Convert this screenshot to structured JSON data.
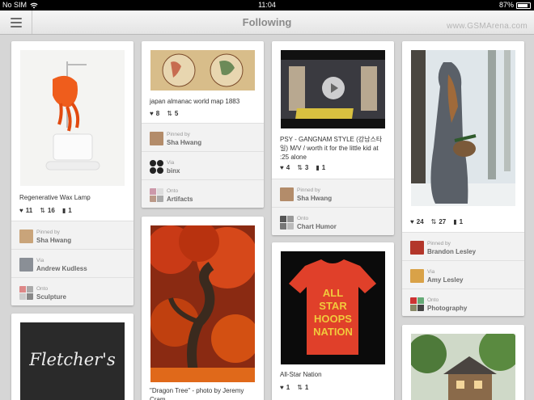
{
  "status": {
    "carrier": "No SIM",
    "time": "11:04",
    "battery": "87%",
    "battery_level": 0.87
  },
  "nav": {
    "title": "Following",
    "watermark": "www.GSMArena.com"
  },
  "pins": {
    "wax_lamp": {
      "title": "Regenerative Wax Lamp",
      "likes": "11",
      "repins": "16",
      "comments": "1",
      "pinned_label": "Pinned by",
      "pinned_by": "Sha Hwang",
      "via_label": "Via",
      "via": "Andrew Kudless",
      "onto_label": "Onto",
      "board": "Sculpture"
    },
    "fletchers": {
      "logo_text": "Fletcher's"
    },
    "almanac": {
      "title": "japan almanac world map 1883",
      "likes": "8",
      "repins": "5",
      "pinned_label": "Pinned by",
      "pinned_by": "Sha Hwang",
      "via_label": "Via",
      "via": "binx",
      "onto_label": "Onto",
      "board": "Artifacts"
    },
    "dragon_tree": {
      "title": "\"Dragon Tree\" - photo by Jeremy Cram"
    },
    "gangnam": {
      "title": "PSY - GANGNAM STYLE (강남스타일) M/V / worth it for the little kid at :25 alone",
      "likes": "4",
      "repins": "3",
      "comments": "1",
      "pinned_label": "Pinned by",
      "pinned_by": "Sha Hwang",
      "onto_label": "Onto",
      "board": "Chart Humor"
    },
    "allstar": {
      "title": "All-Star Nation",
      "likes": "1",
      "repins": "1",
      "shirt_text": "ALL STAR HOOPS NATION"
    },
    "red_hood": {
      "likes": "24",
      "repins": "27",
      "comments": "1",
      "pinned_label": "Pinned by",
      "pinned_by": "Brandon Lesley",
      "via_label": "Via",
      "via": "Amy Lesley",
      "onto_label": "Onto",
      "board": "Photography"
    }
  },
  "icons": {
    "heart": "heart-icon",
    "repin": "repin-icon",
    "comment": "comment-icon"
  },
  "colors": {
    "nav_title": "#8b8b8b",
    "background": "#d6d6d6",
    "meta_bg": "#f2f2f2"
  }
}
